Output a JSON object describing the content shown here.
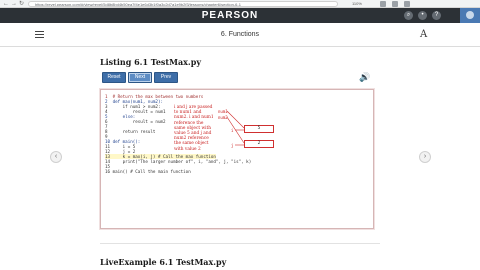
{
  "browser": {
    "back": "←",
    "forward": "→",
    "reload": "↻",
    "url": "https://revel.pearson.com/#/view/revel/5d8b8bd4b50ea7f4e1e6d3b1f0a3c2d7a1e9b2f3/lessons/chapter6/section-6-1",
    "zoom": "110%"
  },
  "header": {
    "title": "PEARSON",
    "icons": [
      "search-icon",
      "bell-icon",
      "help-icon"
    ]
  },
  "chapter": {
    "title": "6. Functions",
    "font_icon": "A"
  },
  "listing": {
    "title": "Listing 6.1 TestMax.py",
    "buttons": {
      "reset": "Reset",
      "next": "Next",
      "prev": "Prev"
    },
    "speaker": "🔊",
    "code": [
      "1  # Return the max between two numbers",
      "2  def max(num1, num2):",
      "3      if num1 > num2:",
      "4          result = num1",
      "5      else:",
      "6          result = num2",
      "7  ",
      "8      return result",
      "9  ",
      "10 def main():",
      "11     i = 5",
      "12     j = 2",
      "13     k = max(i, j) # Call the max function",
      "14     print(\"The larger number of\", i, \"and\", j, \"is\", k)",
      "15 ",
      "16 main() # Call the main function"
    ],
    "note": "i and j are passed to num1 and num2. i and num1 reference the same object with value 5 and j and num2 reference the same object with value 2",
    "var_num1_label": "num1",
    "var_num2_label": "num2",
    "var_i_label": "i",
    "var_j_label": "j",
    "value_5": "5",
    "value_2": "2"
  },
  "nav": {
    "prev": "‹",
    "next": "›"
  },
  "live": {
    "title": "LiveExample 6.1 TestMax.py"
  }
}
